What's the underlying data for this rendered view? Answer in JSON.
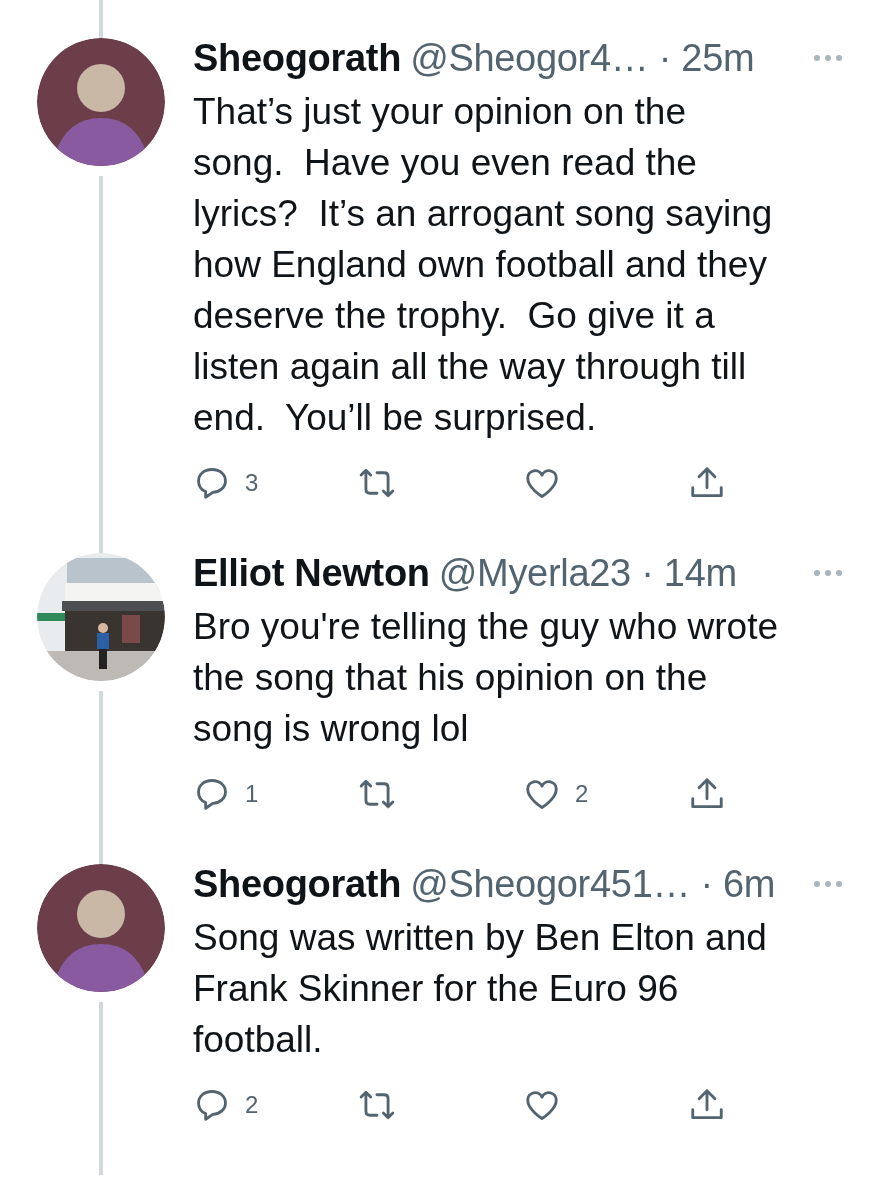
{
  "tweets": [
    {
      "avatar": {
        "kind": "silhouette"
      },
      "name": "Sheogorath",
      "handle": "@Sheogor4…",
      "separator": "·",
      "time": "25m",
      "text": "That’s just your opinion on the\nsong.  Have you even read the\nlyrics?  It’s an arrogant song saying\nhow England own football and they\ndeserve the trophy.  Go give it a\nlisten again all the way through till\nend.  You’ll be surprised.",
      "replies": "3"
    },
    {
      "name": "Elliot Newton",
      "handle": "@Myerla23",
      "separator": "·",
      "time": "14m",
      "text": "Bro you're telling the guy who wrote\nthe song that his opinion on the\nsong is wrong lol",
      "replies": "1",
      "likes": "2"
    },
    {
      "avatar": {
        "kind": "silhouette"
      },
      "name": "Sheogorath",
      "handle": "@Sheogor451…",
      "separator": "·",
      "time": "6m",
      "text": "Song was written by Ben Elton and\nFrank Skinner for the Euro 96\nfootball.",
      "replies": "2"
    }
  ]
}
